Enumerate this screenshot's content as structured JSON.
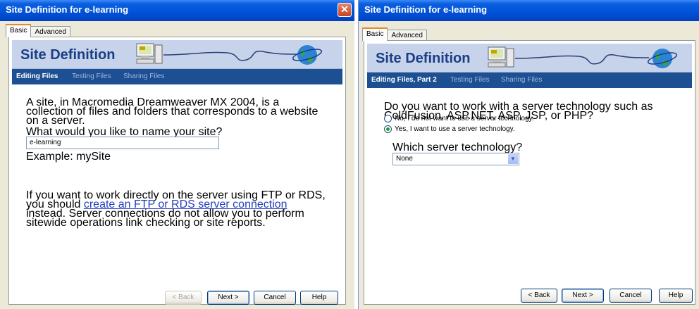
{
  "left": {
    "title": "Site Definition for e-learning",
    "close_glyph": "✕",
    "tabs": [
      "Basic",
      "Advanced"
    ],
    "banner_title": "Site Definition",
    "steps": [
      "Editing Files",
      "Testing Files",
      "Sharing Files"
    ],
    "intro": "A site, in Macromedia Dreamweaver MX 2004, is a collection of files and folders that corresponds to a website on a server.",
    "name_label": "What would you like to name your site?",
    "name_value": "e-learning",
    "example": "Example: mySite",
    "ftp_text_1": "If you want to work directly on the server using FTP or RDS, you should ",
    "ftp_link": "create an FTP or RDS server connection",
    "ftp_text_2": " instead. Server connections do not allow you to perform sitewide operations link checking or site reports.",
    "buttons": {
      "back": "< Back",
      "next": "Next >",
      "cancel": "Cancel",
      "help": "Help"
    }
  },
  "right": {
    "title": "Site Definition for e-learning",
    "tabs": [
      "Basic",
      "Advanced"
    ],
    "banner_title": "Site Definition",
    "steps": [
      "Editing Files, Part 2",
      "Testing Files",
      "Sharing Files"
    ],
    "question": "Do you want to work with a server technology such as ColdFusion, ASP.NET, ASP, JSP, or PHP?",
    "option_no": "No, I do not want to use a server technology.",
    "option_yes": "Yes, I want to use a server technology.",
    "selected_option": "yes",
    "which_label": "Which server technology?",
    "server_tech_value": "None",
    "buttons": {
      "back": "< Back",
      "next": "Next >",
      "cancel": "Cancel",
      "help": "Help"
    }
  },
  "icons": [
    "close-icon",
    "computer-icon",
    "globe-icon",
    "chevron-down-icon"
  ]
}
